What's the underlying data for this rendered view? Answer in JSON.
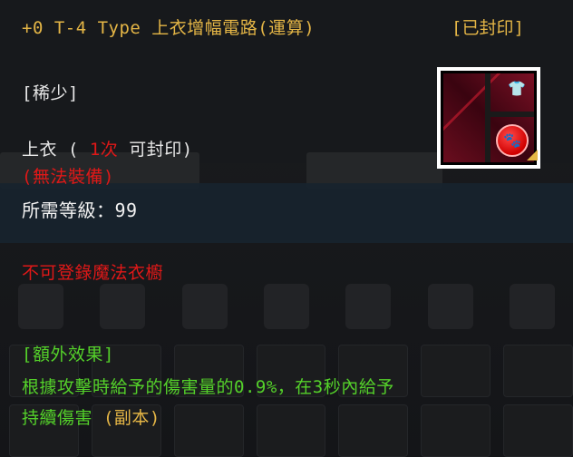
{
  "item": {
    "title": "+0 T-4 Type 上衣增幅電路(運算)",
    "sealed_status": "[已封印]",
    "rarity": "[稀少]",
    "slot_prefix": "上衣 ( ",
    "seal_count": "1次",
    "slot_suffix": " 可封印)",
    "cannot_equip": "(無法裝備)",
    "required_level": "所需等級：99",
    "no_register": "不可登錄魔法衣櫥",
    "extra_effect_header": "[額外效果]",
    "extra_effect_line1": "根據攻擊時給予的傷害量的0.9%，在3秒內給予",
    "extra_effect_line2_text": "持續傷害 ",
    "extra_effect_line2_tag": "(副本)",
    "icon": {
      "name": "top-armor-circuit-icon",
      "sub_icons": [
        "shirt-icon",
        "paw-badge-icon"
      ],
      "frame_color": "#ffffff"
    }
  },
  "colors": {
    "title": "#e5b646",
    "normal": "#e8e8e8",
    "warning": "#e01818",
    "effect": "#54d12a"
  }
}
